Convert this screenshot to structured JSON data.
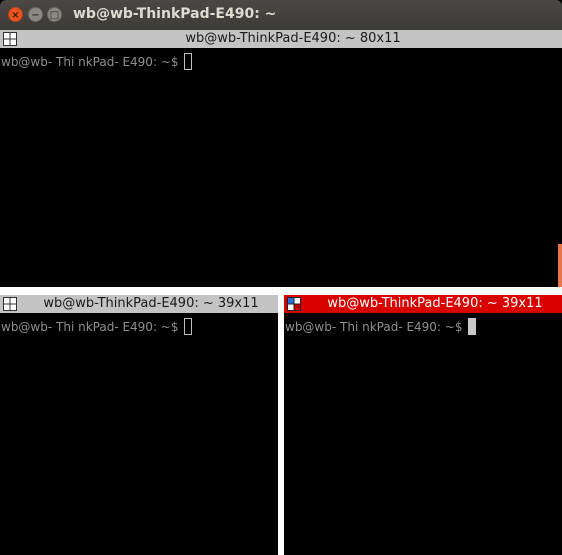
{
  "window": {
    "title": "wb@wb-ThinkPad-E490: ~",
    "close_glyph": "×",
    "minimize_glyph": "−",
    "maximize_glyph": "□"
  },
  "panes": [
    {
      "title": "wb@wb-ThinkPad-E490: ~ 80x11",
      "prompt": "wb@wb- Thi nkPad- E490: ~$",
      "active": false
    },
    {
      "title": "wb@wb-ThinkPad-E490: ~ 39x11",
      "prompt": "wb@wb- Thi nkPad- E490: ~$",
      "active": false
    },
    {
      "title": "wb@wb-ThinkPad-E490: ~ 39x11",
      "prompt": "wb@wb- Thi nkPad- E490: ~$",
      "active": true
    }
  ],
  "colors": {
    "active_bar": "#d90000",
    "inactive_bar": "#c4c4c4",
    "close_button": "#e95420",
    "terminal_bg": "#000000"
  },
  "icons": [
    "close-icon",
    "minimize-icon",
    "maximize-icon",
    "pane-grid-icon"
  ]
}
